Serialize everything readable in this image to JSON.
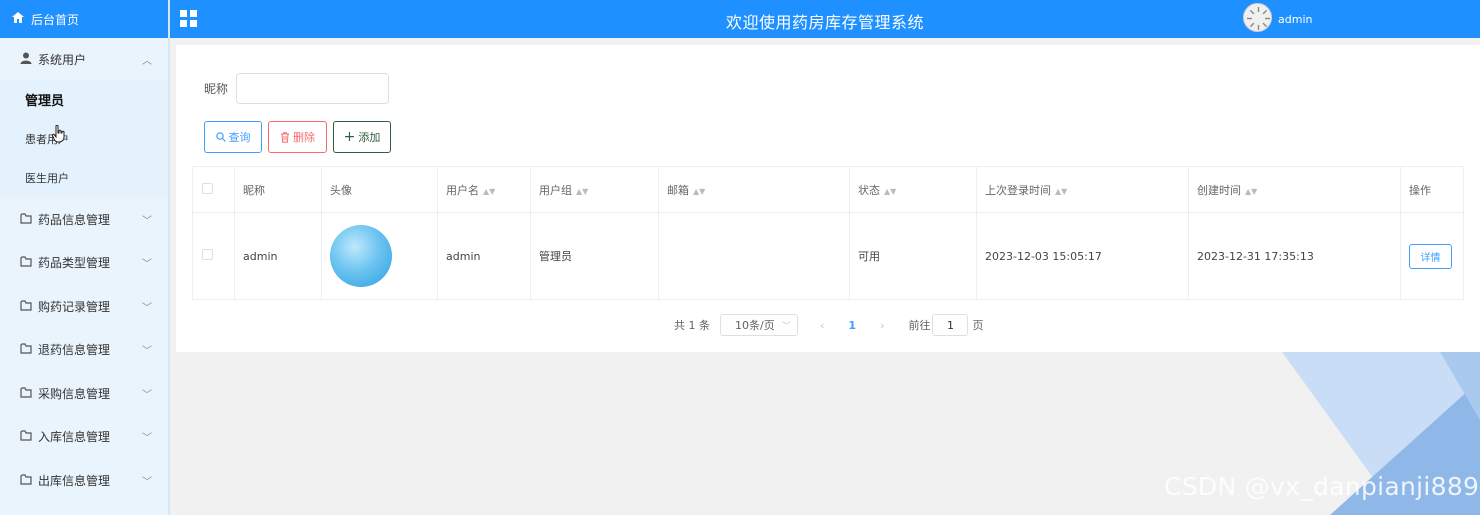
{
  "app": {
    "title": "欢迎使用药房库存管理系统",
    "username": "admin"
  },
  "sidebar": {
    "home": "后台首页",
    "system_users": {
      "label": "系统用户",
      "items": [
        "管理员",
        "患者用户",
        "医生用户"
      ]
    },
    "groups": [
      "药品信息管理",
      "药品类型管理",
      "购药记录管理",
      "退药信息管理",
      "采购信息管理",
      "入库信息管理",
      "出库信息管理"
    ]
  },
  "search": {
    "label": "昵称",
    "value": ""
  },
  "toolbar": {
    "query": "查询",
    "delete": "删除",
    "add": "添加"
  },
  "table": {
    "columns": [
      "昵称",
      "头像",
      "用户名",
      "用户组",
      "邮箱",
      "状态",
      "上次登录时间",
      "创建时间",
      "操作"
    ],
    "rows": [
      {
        "nickname": "admin",
        "username": "admin",
        "group": "管理员",
        "email": "",
        "status": "可用",
        "last_login": "2023-12-03 15:05:17",
        "created": "2023-12-31 17:35:13",
        "action": "详情"
      }
    ]
  },
  "pagination": {
    "total": "共 1 条",
    "page_size": "10条/页",
    "current": "1",
    "goto_label": "前往",
    "goto_value": "1",
    "page_suffix": "页"
  },
  "watermark": "CSDN @vx_danpianji889",
  "colors": {
    "primary": "#1e90ff",
    "sidebar_bg": "#e9f4fd",
    "link": "#409eff",
    "danger": "#f56c6c"
  }
}
